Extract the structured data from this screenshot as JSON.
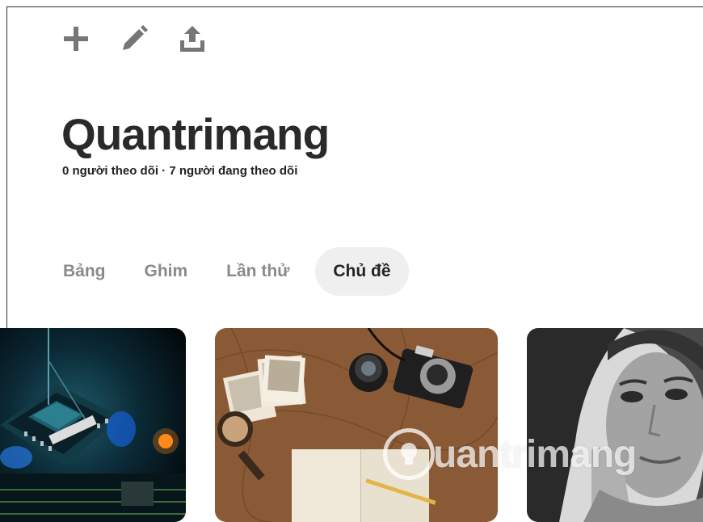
{
  "toolbar": {
    "buttons": [
      {
        "icon": "plus-icon"
      },
      {
        "icon": "pencil-icon"
      },
      {
        "icon": "share-icon"
      }
    ]
  },
  "profile": {
    "name": "Quantrimang",
    "stats": "0 người theo dõi · 7 người đang theo dõi"
  },
  "tabs": [
    {
      "label": "Bảng",
      "active": false
    },
    {
      "label": "Ghim",
      "active": false
    },
    {
      "label": "Lần thử",
      "active": false
    },
    {
      "label": "Chủ đề",
      "active": true
    }
  ],
  "cards": [
    {
      "image": "circuit-board-chip"
    },
    {
      "image": "travel-camera-map-notebook"
    },
    {
      "image": "woman-portrait-bw"
    }
  ],
  "watermark": {
    "text": "uantrimang"
  },
  "colors": {
    "active_tab_bg": "#efefef",
    "inactive_tab_text": "#8a8a8a",
    "icon": "#767676"
  }
}
